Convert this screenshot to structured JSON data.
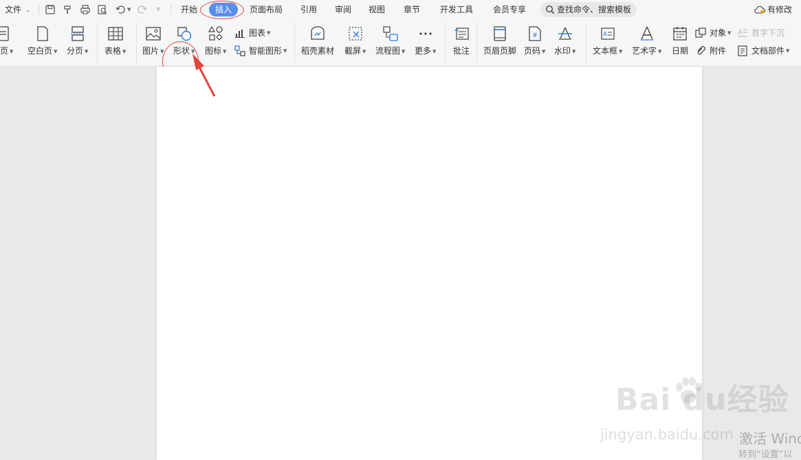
{
  "menubar": {
    "file": "文件",
    "tabs": [
      "开始",
      "插入",
      "页面布局",
      "引用",
      "审阅",
      "视图",
      "章节",
      "开发工具",
      "会员专享"
    ],
    "search_text": "查找命令、搜索模板",
    "status": "有修改"
  },
  "ribbon": {
    "cover_page": "面页",
    "blank_page": "空白页",
    "page_break": "分页",
    "table": "表格",
    "picture": "图片",
    "shape": "形状",
    "icons": "图标",
    "chart": "图表",
    "smart_art": "智能图形",
    "docer_material": "稻壳素材",
    "screenshot": "截屏",
    "flowchart": "流程图",
    "more": "更多",
    "comment": "批注",
    "header_footer": "页眉页脚",
    "page_number": "页码",
    "watermark": "水印",
    "textbox": "文本框",
    "wordart": "艺术字",
    "date": "日期",
    "object": "对象",
    "attachment": "附件",
    "drop_cap": "首字下沉",
    "doc_parts": "文档部件"
  },
  "watermark": {
    "logo_text": "Bai  du经验",
    "url": "jingyan.baidu.com"
  },
  "activation": {
    "line1": "激活 Wind",
    "line2": "转到“设置”以"
  },
  "colors": {
    "accent": "#5b8def",
    "annotation_red": "#e5443c"
  }
}
